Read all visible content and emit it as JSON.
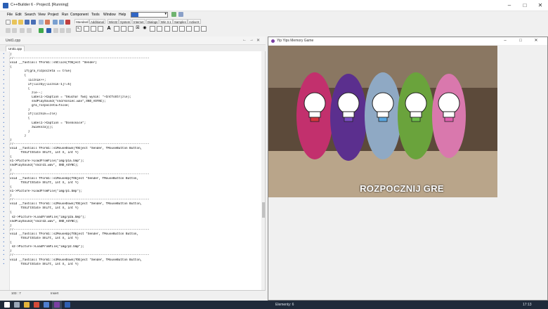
{
  "window": {
    "title": "C++Builder 6 - Project1 [Running]"
  },
  "menu": [
    "File",
    "Edit",
    "Search",
    "View",
    "Project",
    "Run",
    "Component",
    "Tools",
    "Window",
    "Help"
  ],
  "palette_tabs": [
    "Standard",
    "Additional",
    "Win32",
    "System",
    "Internet",
    "Dialogs",
    "Win 3.1",
    "Samples",
    "ActiveX"
  ],
  "editor": {
    "title": "Unit1.cpp",
    "tab": "Unit1.cpp",
    "lines": [
      "}",
      "//---------------------------------------------------------------------------",
      "void __fastcall TForm1::s5Click(TObject *Sender)",
      "{",
      "        if(gra_rozpoczeta == true)",
      "        {",
      "          licznik++;",
      "          if(liczby[licznik-1]!=5)",
      "          {",
      "            zle--;",
      "            Label1->Caption = \"Skucha! Twój wynik: \"+IntToStr(zle);",
      "            sndPlaySound(\"snd/koniec.wav\",SND_ASYNC);",
      "            gra_rozpoczeta=false;",
      "          }",
      "          if(licznik==zle)",
      "          {",
      "            Label1->Caption = \"Doskonale\";",
      "            zwiekszaj();",
      "          }",
      "        }",
      "}",
      "//---------------------------------------------------------------------------",
      "void __fastcall TForm1::s1MouseDown(TObject *Sender, TMouseButton Button,",
      "      TShiftState Shift, int X, int Y)",
      "{",
      "s1->Picture->LoadFromFile(\"img/p1a.bmp\");",
      "sndPlaySound(\"snd/d1.wav\", SND_ASYNC);",
      "}",
      "//---------------------------------------------------------------------------",
      "void __fastcall TForm1::s1MouseUp(TObject *Sender, TMouseButton Button,",
      "      TShiftState Shift, int X, int Y)",
      "{",
      "s1->Picture->LoadFromFile(\"img/p1.bmp\");",
      "}",
      "//---------------------------------------------------------------------------",
      "void __fastcall TForm1::s2MouseDown(TObject *Sender, TMouseButton Button,",
      "      TShiftState Shift, int X, int Y)",
      "{",
      " s2->Picture->LoadFromFile(\"img/p2a.bmp\");",
      "sndPlaySound(\"snd/d2.wav\", SND_ASYNC);",
      "}",
      "//---------------------------------------------------------------------------",
      "void __fastcall TForm1::s2MouseUp(TObject *Sender, TMouseButton Button,",
      "      TShiftState Shift, int X, int Y)",
      "{",
      " s2->Picture->LoadFromFile(\"img/p2.bmp\");",
      "}",
      "//---------------------------------------------------------------------------",
      "void __fastcall TForm1::s3MouseDown(TObject *Sender, TMouseButton Button,",
      "      TShiftState Shift, int X, int Y)"
    ]
  },
  "status": {
    "position": "103 : 7",
    "mode": "Insert"
  },
  "game": {
    "title": "Yip Yips Memory Game",
    "start_label": "ROZPOCZNIJ GRE",
    "bulb_colors": [
      "#d7353f",
      "#7b4fc4",
      "#5aa7df",
      "#6cc04a",
      "#e060b0"
    ]
  },
  "taskbar": {
    "center": "Elementy: 6",
    "time": "17:13"
  }
}
